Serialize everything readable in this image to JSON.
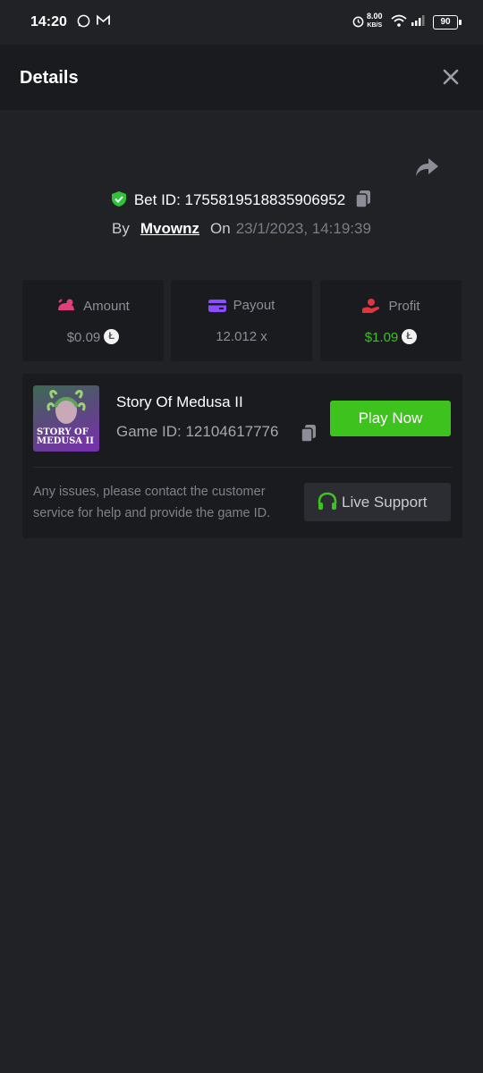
{
  "status_bar": {
    "time": "14:20",
    "net_speed": "8.00",
    "net_unit": "KB/S",
    "battery": "90"
  },
  "header": {
    "title": "Details"
  },
  "bet": {
    "id_label": "Bet ID: 1755819518835906952",
    "by_label": "By",
    "username": "Mvownz",
    "on_label": "On",
    "datetime": "23/1/2023, 14:19:39"
  },
  "stats": {
    "amount_label": "Amount",
    "amount_value": "$0.09",
    "payout_label": "Payout",
    "payout_value": "12.012 x",
    "profit_label": "Profit",
    "profit_value": "$1.09"
  },
  "game": {
    "name": "Story Of Medusa II",
    "id_label": "Game ID: 12104617776",
    "thumb_line1": "STORY OF",
    "thumb_line2": "MEDUSA II",
    "play_label": "Play Now",
    "notice": "Any issues, please contact the customer service for help and provide the game ID.",
    "support_label": "Live Support"
  },
  "colors": {
    "background": "#212226",
    "panel": "#1a1b1f",
    "accent_green": "#3dc21e",
    "amount_icon": "#e0407a",
    "payout_icon": "#8a4dff",
    "profit_icon": "#e0353f"
  }
}
